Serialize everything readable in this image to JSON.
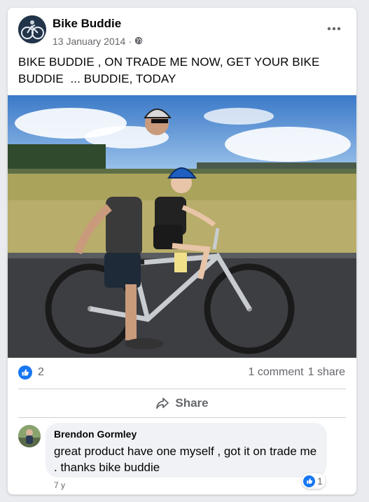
{
  "post": {
    "page_name": "Bike Buddie",
    "date": "13 January 2014",
    "separator": "·",
    "privacy_icon": "globe-icon",
    "more_icon": "more-dots-icon",
    "text": "BIKE BUDDIE , ON TRADE ME NOW, GET YOUR BIKE\nBUDDIE  ... BUDDIE, TODAY",
    "photo_description_icon": "photo"
  },
  "stats": {
    "reaction_icon": "like-icon",
    "reaction_count": "2",
    "comments": "1 comment",
    "shares": "1 share"
  },
  "actions": {
    "share_label": "Share",
    "share_icon": "share-arrow-icon"
  },
  "comment": {
    "author": "Brendon Gormley",
    "text": "great product have one myself , got it on trade me . thanks bike buddie",
    "reaction_count": "1",
    "time": "7 y"
  },
  "colors": {
    "accent": "#1877f2",
    "secondary_text": "#65676b",
    "primary_text": "#050505",
    "bubble": "#f0f2f5"
  }
}
